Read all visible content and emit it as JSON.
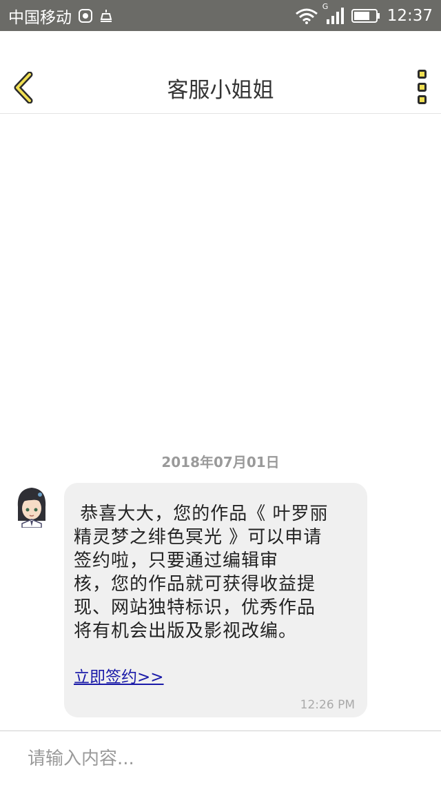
{
  "status_bar": {
    "carrier": "中国移动",
    "network_type": "G",
    "time": "12:37",
    "icons": [
      "huawei-icon",
      "notification-icon",
      "wifi-icon",
      "signal-icon",
      "battery-icon"
    ]
  },
  "header": {
    "title": "客服小姐姐",
    "back_icon": "chevron-left-icon",
    "more_icon": "more-vertical-icon",
    "accent_color": "#f0df52"
  },
  "chat": {
    "date": "2018年07月01日",
    "messages": [
      {
        "sender": "agent",
        "text": " 恭喜大大，您的作品《 叶罗丽\n精灵梦之绯色冥光 》可以申请\n签约啦，只要通过编辑审\n核，您的作品就可获得收益提\n现、网站独特标识，优秀作品\n将有机会出版及影视改编。",
        "link_text": "立即签约>>",
        "time": "12:26 PM"
      }
    ]
  },
  "input": {
    "placeholder": "请输入内容..."
  }
}
